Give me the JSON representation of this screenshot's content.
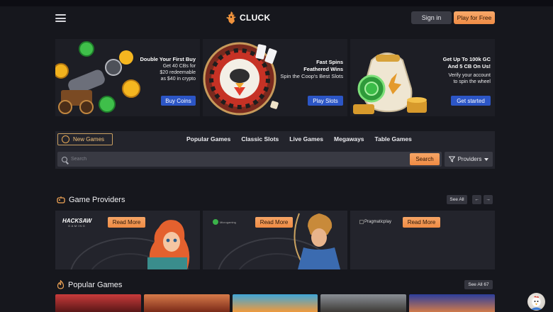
{
  "header": {
    "brand": "CLUCK",
    "signin_label": "Sign in",
    "play_label": "Play for Free"
  },
  "banners": [
    {
      "title": "Double Your First Buy",
      "lines": [
        "Get 40 CBs for",
        "$20 redeemable",
        "as $40 in crypto"
      ],
      "cta": "Buy Coins"
    },
    {
      "title": "Fast Spins",
      "title2": "Feathered Wins",
      "lines": [
        "Spin the Coop's Best Slots"
      ],
      "cta": "Play Slots"
    },
    {
      "title": "Get Up To 100k GC",
      "title2": "And 5 CB On Us!",
      "lines": [
        "Verify your account",
        "to spin the wheel"
      ],
      "cta": "Get started"
    }
  ],
  "nav": {
    "new_games": "New Games",
    "links": [
      "Popular Games",
      "Classic Slots",
      "Live Games",
      "Megaways",
      "Table Games"
    ]
  },
  "search": {
    "placeholder": "Search",
    "button": "Search",
    "providers_label": "Providers"
  },
  "providers_section": {
    "title": "Game Providers",
    "see_all": "See All",
    "prev": "←",
    "next": "→",
    "cards": [
      {
        "logo_line1": "HACKSAW",
        "logo_line2": "GAMING",
        "cta": "Read More"
      },
      {
        "logo": "Microgaming",
        "cta": "Read More"
      },
      {
        "logo": "Pragmaticplay",
        "cta": "Read More"
      }
    ]
  },
  "popular_section": {
    "title": "Popular Games",
    "see_all": "See All 67"
  },
  "colors": {
    "background": "#16171d",
    "panel": "#23242c",
    "accent_orange": "#f08c46",
    "accent_blue": "#2c56c6"
  }
}
